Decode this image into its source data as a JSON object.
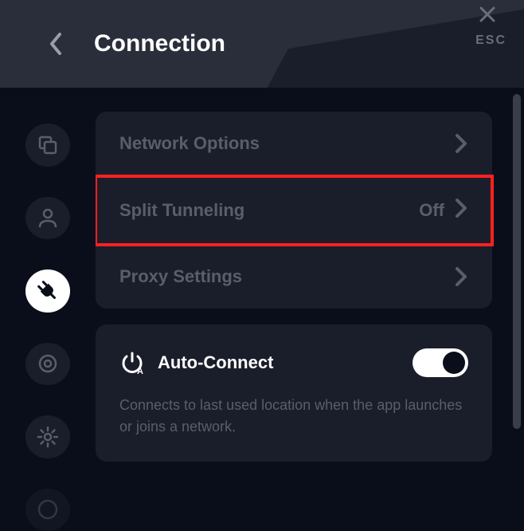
{
  "header": {
    "title": "Connection",
    "esc_label": "ESC"
  },
  "sidebar": {
    "items": [
      {
        "id": "general",
        "active": false
      },
      {
        "id": "account",
        "active": false
      },
      {
        "id": "connection",
        "active": true
      },
      {
        "id": "privacy",
        "active": false
      },
      {
        "id": "settings",
        "active": false
      },
      {
        "id": "help",
        "active": false
      }
    ]
  },
  "settings": {
    "network_options": {
      "label": "Network Options"
    },
    "split_tunneling": {
      "label": "Split Tunneling",
      "value": "Off"
    },
    "proxy_settings": {
      "label": "Proxy Settings"
    }
  },
  "auto_connect": {
    "title": "Auto-Connect",
    "description": "Connects to last used location when the app launches or joins a network.",
    "enabled": true
  }
}
